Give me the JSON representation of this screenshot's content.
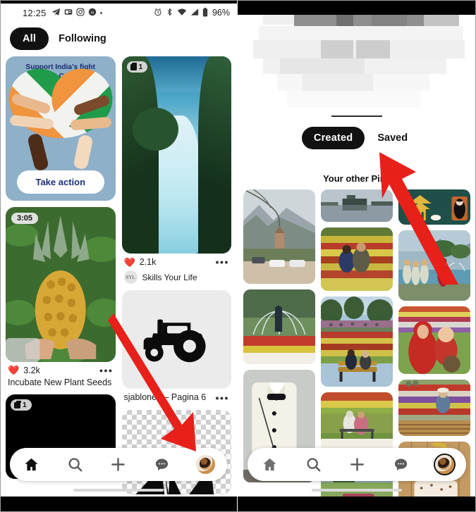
{
  "left_phone": {
    "status_bar": {
      "time": "12:25",
      "left_icons": [
        "telegram-icon",
        "news-icon",
        "instagram-icon",
        "badge-icon",
        "dot-icon"
      ],
      "right_icons": [
        "alarm-icon",
        "bluetooth-icon",
        "wifi-icon",
        "signal-icon",
        "battery-icon"
      ],
      "battery": "96%"
    },
    "feed_tabs": [
      {
        "label": "All",
        "active": true
      },
      {
        "label": "Following",
        "active": false
      }
    ],
    "pins": {
      "covid": {
        "headline": "Support India's fight against Covid-19",
        "cta": "Take action"
      },
      "waterfall": {
        "carousel_badge": "1",
        "likes": "2.1k",
        "author_initials": "SYL",
        "author": "Skills Your Life"
      },
      "pineapple": {
        "duration": "3:05",
        "likes": "3.2k",
        "title": "Incubate New Plant Seeds"
      },
      "tractor": {
        "title": "sjablonen – Pagina 6"
      },
      "black_pin": {
        "carousel_badge": "1"
      }
    },
    "bottom_nav": [
      {
        "name": "home",
        "icon": "home-icon",
        "active": true
      },
      {
        "name": "search",
        "icon": "search-icon",
        "active": false
      },
      {
        "name": "create",
        "icon": "plus-icon",
        "active": false
      },
      {
        "name": "messages",
        "icon": "chat-bubble-icon",
        "active": false
      },
      {
        "name": "profile",
        "icon": "avatar-icon",
        "active": false
      }
    ]
  },
  "right_phone": {
    "profile_header": {
      "blurred": true,
      "note": ""
    },
    "profile_tabs": [
      {
        "label": "Created",
        "active": true
      },
      {
        "label": "Saved",
        "active": false
      }
    ],
    "section_heading": "Your other Pins",
    "bottom_nav": [
      {
        "name": "home",
        "icon": "home-icon",
        "active": false
      },
      {
        "name": "search",
        "icon": "search-icon",
        "active": false
      },
      {
        "name": "create",
        "icon": "plus-icon",
        "active": false
      },
      {
        "name": "messages",
        "icon": "chat-bubble-icon",
        "active": false
      },
      {
        "name": "profile",
        "icon": "avatar-icon",
        "active": true
      }
    ]
  },
  "annotations": {
    "accent_color": "#e8201a",
    "left_arrow": {
      "points_to": "profile-nav-icon",
      "direction": "down-right"
    },
    "right_arrow": {
      "points_to": "saved-tab",
      "direction": "up-left"
    }
  },
  "grid_pins": {
    "col1": [
      "mountain-valley-parked-cars",
      "fountain-tulip-garden-couple",
      "tuxedo-shirt-cake"
    ],
    "col2": [
      "lake-island-reflection",
      "tulip-field-couple-sitting",
      "park-tulip-rows-bench",
      "tulip-field-family-bench",
      "sunset-wedding-lawn-chairs"
    ],
    "col3": [
      "pagoda-green-illustration",
      "fountain-crowd-mountain",
      "woman-red-child-tulip-lawn",
      "tulip-rows-farmer-cart",
      "wedding-tiered-cake"
    ]
  }
}
